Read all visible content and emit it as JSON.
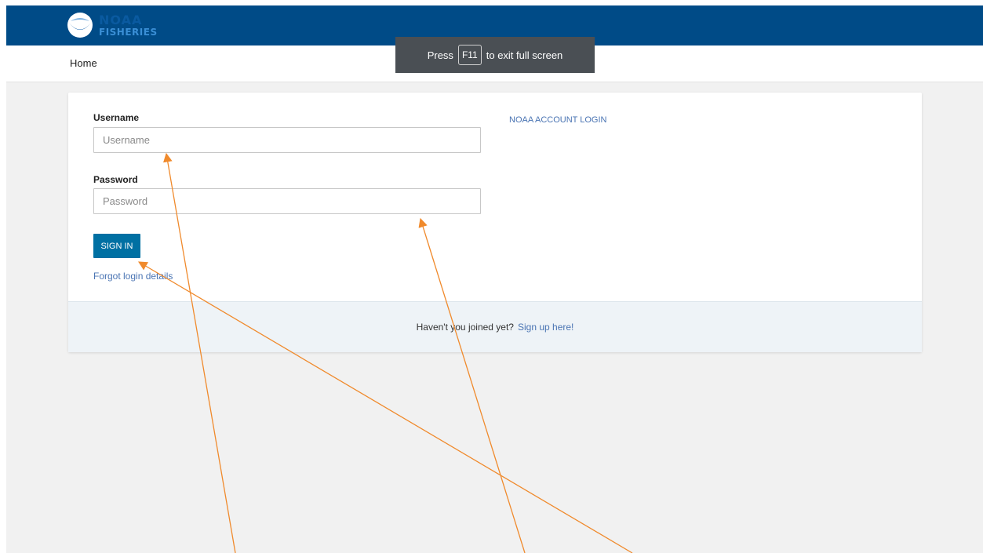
{
  "header": {
    "logo_line1": "NOAA",
    "logo_line2": "FISHERIES"
  },
  "nav": {
    "home_label": "Home"
  },
  "fullscreen_banner": {
    "press": "Press",
    "key": "F11",
    "suffix": "to exit full screen"
  },
  "login": {
    "username_label": "Username",
    "username_placeholder": "Username",
    "username_value": "",
    "password_label": "Password",
    "password_placeholder": "Password",
    "password_value": "",
    "signin_label": "SIGN IN",
    "forgot_label": "Forgot login details",
    "noaa_account_login_label": "NOAA ACCOUNT LOGIN"
  },
  "signup": {
    "prompt": "Haven't you joined yet?",
    "link_label": "Sign up here!"
  },
  "colors": {
    "header_bg": "#004b87",
    "button_bg": "#0070a3",
    "link": "#4a74b3",
    "annotation_arrow": "#f08a2c"
  },
  "icons": {
    "logo": "noaa-logo-icon"
  }
}
